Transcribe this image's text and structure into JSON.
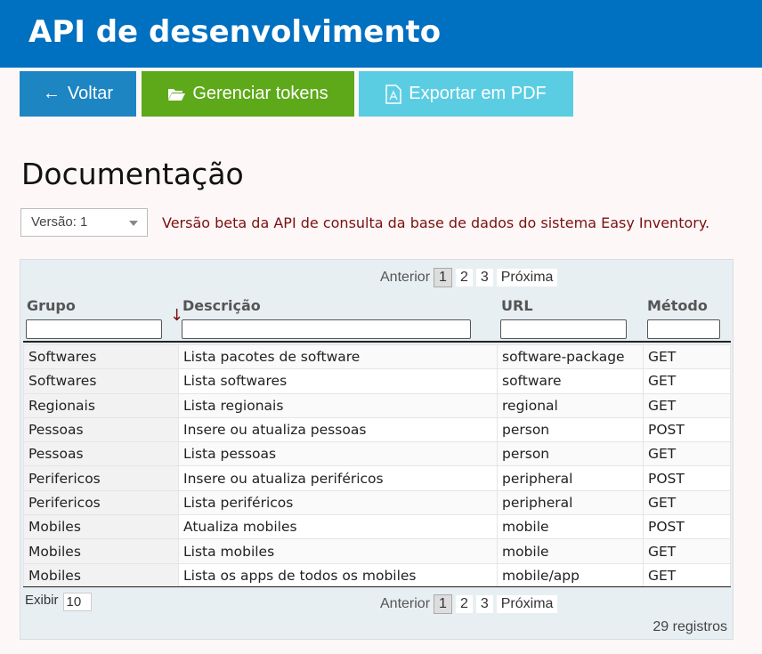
{
  "header": {
    "title": "API de desenvolvimento"
  },
  "toolbar": {
    "back": "Voltar",
    "tokens": "Gerenciar tokens",
    "pdf": "Exportar em PDF"
  },
  "page": {
    "title": "Documentação",
    "version": "Versão: 1",
    "note": "Versão beta da API de consulta da base de dados do sistema Easy Inventory."
  },
  "pager": {
    "prev": "Anterior",
    "pages": [
      "1",
      "2",
      "3"
    ],
    "next": "Próxima"
  },
  "columns": [
    "Grupo",
    "Descrição",
    "URL",
    "Método"
  ],
  "rows": [
    [
      "Softwares",
      "Lista pacotes de software",
      "software-package",
      "GET"
    ],
    [
      "Softwares",
      "Lista softwares",
      "software",
      "GET"
    ],
    [
      "Regionais",
      "Lista regionais",
      "regional",
      "GET"
    ],
    [
      "Pessoas",
      "Insere ou atualiza pessoas",
      "person",
      "POST"
    ],
    [
      "Pessoas",
      "Lista pessoas",
      "person",
      "GET"
    ],
    [
      "Perifericos",
      "Insere ou atualiza periféricos",
      "peripheral",
      "POST"
    ],
    [
      "Perifericos",
      "Lista periféricos",
      "peripheral",
      "GET"
    ],
    [
      "Mobiles",
      "Atualiza mobiles",
      "mobile",
      "POST"
    ],
    [
      "Mobiles",
      "Lista mobiles",
      "mobile",
      "GET"
    ],
    [
      "Mobiles",
      "Lista os apps de todos os mobiles",
      "mobile/app",
      "GET"
    ]
  ],
  "footer": {
    "show_label": "Exibir",
    "show_value": "10",
    "count": "29 registros"
  }
}
